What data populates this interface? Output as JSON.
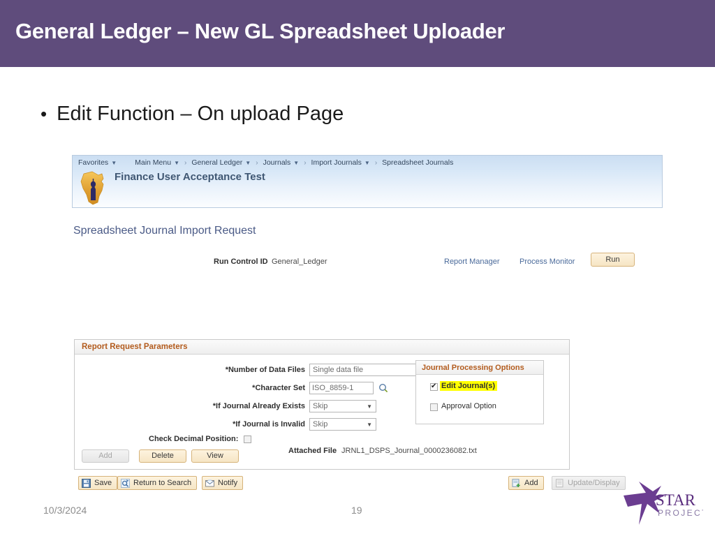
{
  "slide": {
    "title": "General Ledger – New GL Spreadsheet Uploader",
    "bullet": "Edit Function – On upload Page",
    "bullet_marker": "•",
    "footer_date": "10/3/2024",
    "footer_number": "19",
    "banner_color": "#5f4c7c",
    "logo": {
      "name": "star-project-logo",
      "line1": "STAR",
      "line2": "PROJECT",
      "color": "#6b3d91"
    }
  },
  "app": {
    "breadcrumb": [
      {
        "label": "Favorites",
        "has_caret": true
      },
      {
        "label": "Main Menu",
        "has_caret": true
      },
      {
        "label": "General Ledger",
        "has_caret": true
      },
      {
        "label": "Journals",
        "has_caret": true
      },
      {
        "label": "Import Journals",
        "has_caret": true
      },
      {
        "label": "Spreadsheet Journals",
        "has_caret": false
      }
    ],
    "separator": "›",
    "app_title": "Finance User Acceptance Test",
    "page_title": "Spreadsheet Journal Import Request",
    "run_control": {
      "label": "Run Control ID",
      "value": "General_Ledger"
    },
    "links": {
      "report_manager": "Report Manager",
      "process_monitor": "Process Monitor"
    },
    "run_button": "Run",
    "params": {
      "header": "Report Request Parameters",
      "number_of_data_files": {
        "label": "*Number of Data Files",
        "value": "Single data file"
      },
      "character_set": {
        "label": "*Character Set",
        "value": "ISO_8859-1"
      },
      "if_journal_already_exists": {
        "label": "*If Journal Already Exists",
        "value": "Skip"
      },
      "if_journal_is_invalid": {
        "label": "*If Journal is Invalid",
        "value": "Skip"
      },
      "check_decimal_position": {
        "label": "Check Decimal Position:",
        "checked": false
      },
      "buttons": {
        "add": "Add",
        "delete": "Delete",
        "view": "View"
      },
      "attached_file": {
        "label": "Attached File",
        "value": "JRNL1_DSPS_Journal_0000236082.txt"
      }
    },
    "journal_processing_options": {
      "header": "Journal Processing Options",
      "edit_journals": {
        "label": "Edit Journal(s)",
        "checked": true,
        "highlight": true,
        "highlight_color": "#ffff00"
      },
      "approval_option": {
        "label": "Approval Option",
        "checked": false,
        "highlight": false
      }
    },
    "toolbar": {
      "save": "Save",
      "return_to_search": "Return to Search",
      "notify": "Notify",
      "add": "Add",
      "update_display": "Update/Display"
    }
  }
}
